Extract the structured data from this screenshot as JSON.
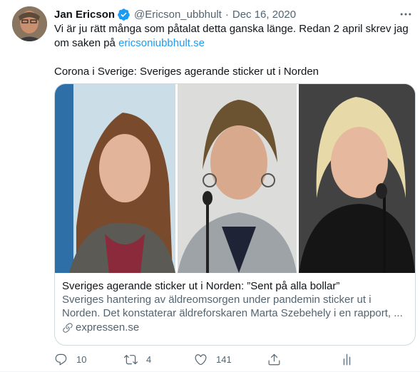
{
  "tweet": {
    "author_name": "Jan Ericson",
    "handle": "@Ericson_ubbhult",
    "separator": "·",
    "date": "Dec 16, 2020",
    "text_line1": "Vi är ju rätt många som påtalat detta ganska länge. Redan 2 april skrev jag om saken på ",
    "text_link": "ericsoniubbhult.se",
    "text_para2": "Corona i Sverige: Sveriges agerande sticker ut i Norden"
  },
  "card": {
    "title": "Sveriges agerande sticker ut i Norden: ”Sent på alla bollar”",
    "description": "Sveriges hantering av äldreomsorgen under pandemin sticker ut i Norden. Det konstaterar äldreforskaren Marta Szebehely i en rapport, ...",
    "domain": "expressen.se"
  },
  "actions": {
    "reply_count": "10",
    "retweet_count": "4",
    "like_count": "141"
  },
  "icons": {
    "verified": "verified-badge-icon",
    "more": "more-icon",
    "link": "link-icon",
    "reply": "reply-icon",
    "retweet": "retweet-icon",
    "like": "heart-icon",
    "share": "share-icon",
    "analytics": "analytics-icon"
  },
  "colors": {
    "accent": "#1d9bf0",
    "secondary_text": "#536471",
    "text": "#0f1419",
    "border": "#cfd9de"
  }
}
